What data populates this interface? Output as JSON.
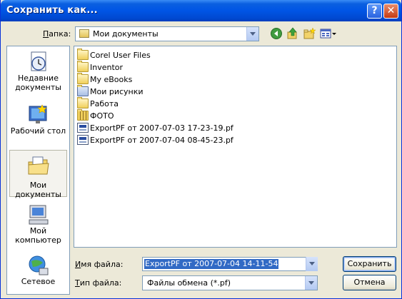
{
  "window": {
    "title": "Сохранить как...",
    "help_label": "?",
    "close_label": "✕"
  },
  "toolbar": {
    "folder_label_u": "П",
    "folder_label_rest": "апка:",
    "current_folder": "Мои документы",
    "icons": [
      "back-icon",
      "up-folder-icon",
      "new-folder-icon",
      "view-menu-icon"
    ]
  },
  "places": [
    {
      "label_line1": "Недавние",
      "label_line2": "документы",
      "icon": "recent-documents-icon"
    },
    {
      "label_line1": "Рабочий стол",
      "label_line2": "",
      "icon": "desktop-icon"
    },
    {
      "label_line1": "Мои документы",
      "label_line2": "",
      "icon": "my-documents-icon",
      "selected": true
    },
    {
      "label_line1": "Мой",
      "label_line2": "компьютер",
      "icon": "my-computer-icon"
    },
    {
      "label_line1": "Сетевое",
      "label_line2": "",
      "icon": "network-icon"
    }
  ],
  "files": [
    {
      "name": "Corel User Files",
      "type": "folder"
    },
    {
      "name": "Inventor",
      "type": "folder"
    },
    {
      "name": "My eBooks",
      "type": "folder"
    },
    {
      "name": "Мои рисунки",
      "type": "pictures-folder"
    },
    {
      "name": "Работа",
      "type": "folder"
    },
    {
      "name": "ФОТО",
      "type": "photo-folder"
    },
    {
      "name": "ExportPF от 2007-07-03 17-23-19.pf",
      "type": "document"
    },
    {
      "name": "ExportPF от 2007-07-04 08-45-23.pf",
      "type": "document"
    }
  ],
  "form": {
    "filename_label_u": "И",
    "filename_label_rest": "мя файла:",
    "filename_value": "ExportPF от 2007-07-04 14-11-54",
    "filetype_label_u": "Т",
    "filetype_label_rest": "ип файла:",
    "filetype_value": "Файлы обмена (*.pf)"
  },
  "buttons": {
    "save": "Сохранить",
    "cancel": "Отмена"
  },
  "colors": {
    "title_bar": "#0055e5",
    "selection": "#316ac5",
    "dialog_bg": "#ece9d8"
  }
}
